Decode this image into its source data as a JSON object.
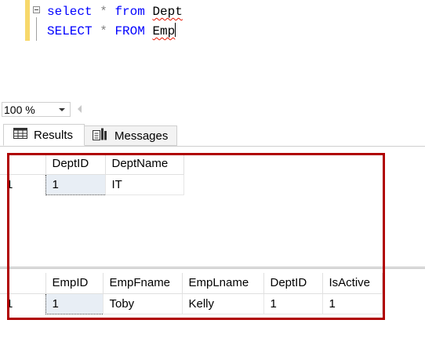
{
  "editor": {
    "line1": {
      "kw1": "select",
      "star": "*",
      "kw2": "from",
      "table": "Dept"
    },
    "line2": {
      "kw1": "SELECT",
      "star": "*",
      "kw2": "FROM",
      "table": "Emp"
    }
  },
  "zoom": {
    "value": "100 %"
  },
  "tabs": [
    {
      "label": "Results",
      "icon": "grid-icon"
    },
    {
      "label": "Messages",
      "icon": "messages-icon"
    }
  ],
  "result1": {
    "columns": [
      "DeptID",
      "DeptName"
    ],
    "rows": [
      {
        "num": "1",
        "cells": [
          "1",
          "IT"
        ]
      }
    ]
  },
  "result2": {
    "columns": [
      "EmpID",
      "EmpFname",
      "EmpLname",
      "DeptID",
      "IsActive"
    ],
    "rows": [
      {
        "num": "1",
        "cells": [
          "1",
          "Toby",
          "Kelly",
          "1",
          "1"
        ]
      }
    ]
  },
  "colors": {
    "highlight": "#b00000",
    "keyword": "#0000ff",
    "squiggle": "#e51400"
  }
}
